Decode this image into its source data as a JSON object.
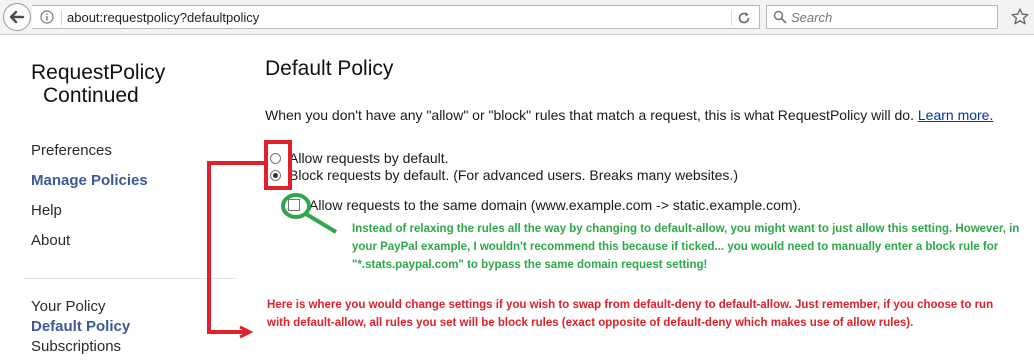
{
  "browser": {
    "url": "about:requestpolicy?defaultpolicy",
    "search_placeholder": "Search"
  },
  "sidebar": {
    "brand_line1": "RequestPolicy",
    "brand_line2": "Continued",
    "items": [
      {
        "label": "Preferences"
      },
      {
        "label": "Manage Policies",
        "active": true
      },
      {
        "label": "Help"
      },
      {
        "label": "About"
      },
      {
        "label": "Your Policy"
      },
      {
        "label": "Default Policy",
        "active": true
      },
      {
        "label": "Subscriptions"
      }
    ]
  },
  "main": {
    "title": "Default Policy",
    "intro": "When you don't have any \"allow\" or \"block\" rules that match a request, this is what RequestPolicy will do.",
    "learn_more": "Learn more.",
    "option_allow": "Allow requests by default.",
    "option_block": "Block requests by default. (For advanced users. Breaks many websites.)",
    "selected_option": "block",
    "same_domain_label": "Allow requests to the same domain (www.example.com -> static.example.com).",
    "same_domain_checked": false
  },
  "annotations": {
    "green_note": "Instead of relaxing the rules all the way by changing to default-allow, you might want to just allow this setting. However, in your PayPal example, I wouldn't recommend this because if ticked... you would need to manually enter a block rule for \"*.stats.paypal.com\" to bypass the same domain request setting!",
    "red_note": "Here is where you would change settings if you wish to swap from default-deny to default-allow. Just remember, if you choose to run with default-allow, all rules you set will be block rules (exact opposite of default-deny which makes use of allow rules).",
    "green_color": "#2ea84a",
    "red_color": "#e0202a"
  }
}
